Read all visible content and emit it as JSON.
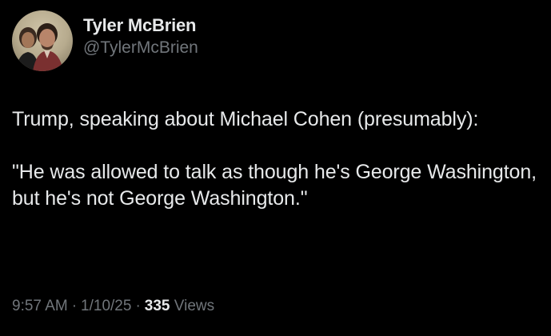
{
  "author": {
    "display_name": "Tyler McBrien",
    "handle": "@TylerMcBrien"
  },
  "tweet": {
    "paragraphs": [
      "Trump, speaking about Michael Cohen (presumably):",
      "\"He was allowed to talk as though he's George Washington, but he's not George Washington.\""
    ]
  },
  "meta": {
    "time": "9:57 AM",
    "separator": "·",
    "date": "1/10/25",
    "views_count": "335",
    "views_label": "Views"
  },
  "colors": {
    "background": "#000000",
    "primary_text": "#e7e9ea",
    "secondary_text": "#71767b"
  }
}
